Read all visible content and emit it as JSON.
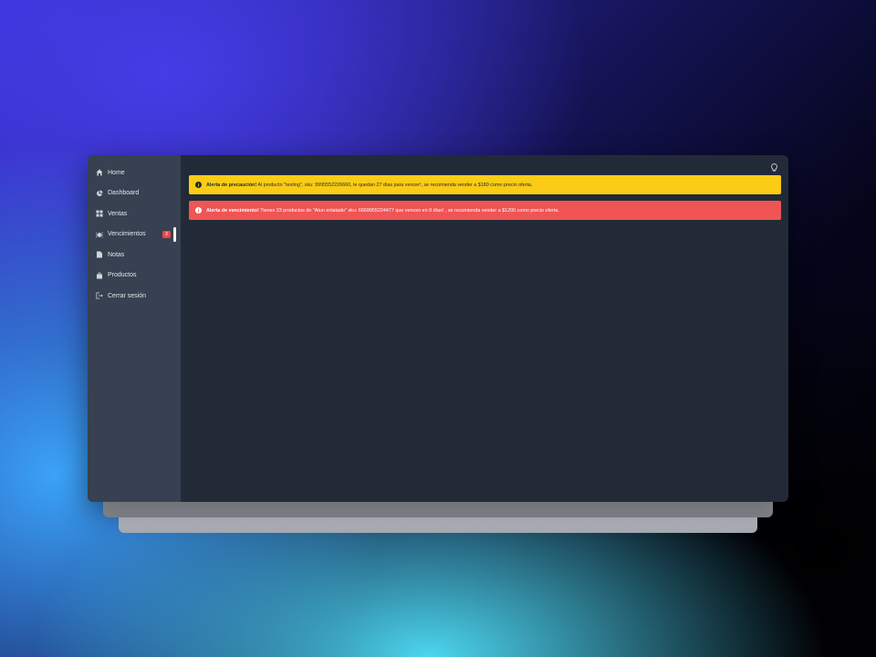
{
  "sidebar": {
    "items": [
      {
        "label": "Home",
        "icon": "home-icon"
      },
      {
        "label": "Dashboard",
        "icon": "chart-pie-icon"
      },
      {
        "label": "Ventas",
        "icon": "grid-icon"
      },
      {
        "label": "Vencimientos",
        "icon": "bug-icon",
        "badge": "3"
      },
      {
        "label": "Notas",
        "icon": "note-icon"
      },
      {
        "label": "Productos",
        "icon": "bag-icon"
      },
      {
        "label": "Cerrar sesión",
        "icon": "logout-icon"
      }
    ]
  },
  "header": {
    "theme_toggle_icon": "lightbulb-icon"
  },
  "alerts": [
    {
      "type": "warning",
      "color": "#facc15",
      "title": "Alerta de precaución!",
      "message": " Al producto \"testing\", sku: 9995552226660, le quedan 27 días para vencer!, se recomienda vender a $180 como precio oferta."
    },
    {
      "type": "danger",
      "color": "#ef5555",
      "title": "Alerta de vencimiento!",
      "message": " Tienes 23 productos de \"Atun enlatado\" sku: 6669955224477 que vencen en 8 días! , se recomienda vender a $1200 como precio oferta."
    }
  ],
  "colors": {
    "sidebar_bg": "#374151",
    "main_bg": "#222a37",
    "badge": "#ef4444"
  }
}
